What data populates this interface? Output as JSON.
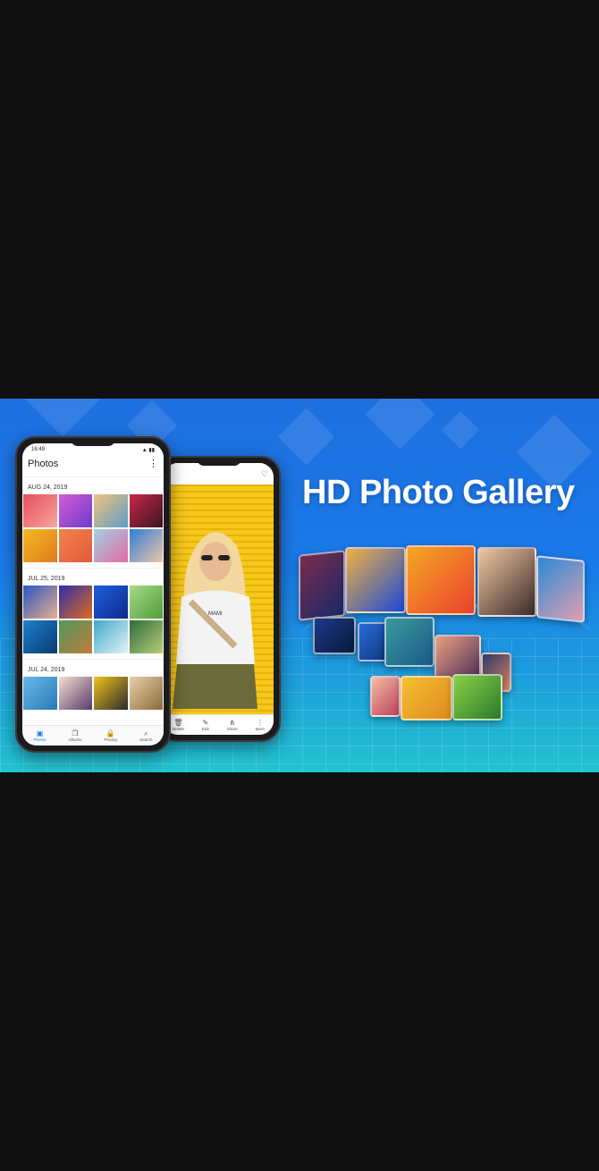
{
  "headline": "HD Photo Gallery",
  "phone_main": {
    "status_time": "16:49",
    "status_right": "▲ ▮▮",
    "title": "Photos",
    "menu_icon": "more-vertical-icon",
    "sections": [
      {
        "date": "AUG 24, 2019"
      },
      {
        "date": "JUL 25, 2019"
      },
      {
        "date": "JUL 24, 2019"
      }
    ],
    "nav": [
      {
        "label": "Photos",
        "icon": "photos-icon"
      },
      {
        "label": "Albums",
        "icon": "albums-icon"
      },
      {
        "label": "Privacy",
        "icon": "lock-icon"
      },
      {
        "label": "Search",
        "icon": "search-icon"
      }
    ]
  },
  "phone_viewer": {
    "shirt_text": "MAMI",
    "nav": [
      {
        "label": "Delete",
        "icon": "trash-icon"
      },
      {
        "label": "Edit",
        "icon": "pencil-icon"
      },
      {
        "label": "Share",
        "icon": "share-icon"
      },
      {
        "label": "More",
        "icon": "more-vertical-icon"
      }
    ]
  },
  "colors": {
    "banner_top": "#1e6fe0",
    "banner_bottom": "#23c3cf",
    "accent": "#1a73e8",
    "viewer_background": "#f6c81a"
  }
}
